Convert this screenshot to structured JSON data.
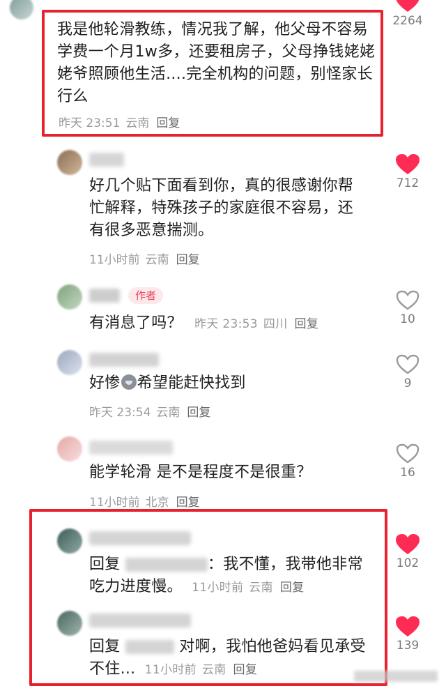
{
  "comments": [
    {
      "text": "我是他轮滑教练，情况我了解，他父母不容易学费一个月1w多，还要租房子，父母挣钱姥姥姥爷照顾他生活....完全机构的问题，别怪家长行么",
      "time": "昨天 23:51",
      "location": "云南",
      "reply": "回复",
      "likes": "2264",
      "liked": true
    },
    {
      "text": "好几个贴下面看到你，真的很感谢你帮忙解释，特殊孩子的家庭很不容易，还有很多恶意揣测。",
      "time": "11小时前",
      "location": "云南",
      "reply": "回复",
      "likes": "712",
      "liked": true
    },
    {
      "author_tag": "作者",
      "text": "有消息了吗？",
      "time": "昨天 23:53",
      "location": "四川",
      "reply": "回复",
      "likes": "10",
      "liked": false
    },
    {
      "text_before": "好惨",
      "emoji": "crying-face",
      "text_after": "希望能赶快找到",
      "time": "昨天 23:54",
      "location": "云南",
      "reply": "回复",
      "likes": "9",
      "liked": false
    },
    {
      "text": "能学轮滑 是不是程度不是很重？",
      "time": "11小时前",
      "location": "北京",
      "reply": "回复",
      "likes": "16",
      "liked": false
    },
    {
      "reply_prefix": "回复",
      "text": "：我不懂，我带他非常吃力进度慢。",
      "time": "11小时前",
      "location": "云南",
      "reply": "回复",
      "likes": "102",
      "liked": true
    },
    {
      "reply_prefix": "回复",
      "text": " 对啊，我怕他爸妈看见承受不住...",
      "time": "11小时前",
      "location": "云南",
      "reply": "回复",
      "likes": "139",
      "liked": true
    }
  ],
  "colors": {
    "like_active": "#fe2c55",
    "like_inactive": "#9a9a9a",
    "highlight": "#e8212f"
  }
}
